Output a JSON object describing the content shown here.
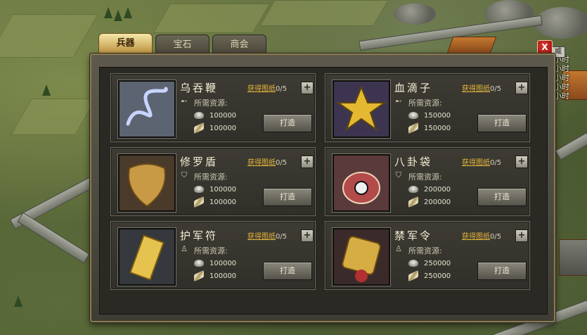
{
  "tabs": [
    {
      "label": "兵器",
      "active": true
    },
    {
      "label": "宝石",
      "active": false
    },
    {
      "label": "商会",
      "active": false
    }
  ],
  "close_label": "X",
  "close_tail_text": "威",
  "side_hints": [
    "小时",
    "小时",
    "小时",
    "小时",
    "小时"
  ],
  "card_common": {
    "blueprint_link": "获得图纸",
    "required_label": "所需资源:",
    "forge_label": "打造",
    "plus_label": "+"
  },
  "items": [
    {
      "name": "乌吞鞭",
      "count": "0/5",
      "req_icon": "whip-icon",
      "silver": "100000",
      "wood": "100000",
      "theme": "#6b7bd0",
      "art": "whip"
    },
    {
      "name": "血滴子",
      "count": "0/5",
      "req_icon": "whip-icon",
      "silver": "150000",
      "wood": "150000",
      "theme": "#e4b830",
      "art": "star"
    },
    {
      "name": "修罗盾",
      "count": "0/5",
      "req_icon": "shield-icon",
      "silver": "100000",
      "wood": "100000",
      "theme": "#c89a45",
      "art": "shield"
    },
    {
      "name": "八卦袋",
      "count": "0/5",
      "req_icon": "shield-icon",
      "silver": "200000",
      "wood": "200000",
      "theme": "#b44b4b",
      "art": "bag"
    },
    {
      "name": "护军符",
      "count": "0/5",
      "req_icon": "person-icon",
      "silver": "100000",
      "wood": "100000",
      "theme": "#e6c24f",
      "art": "talisman"
    },
    {
      "name": "禁军令",
      "count": "0/5",
      "req_icon": "person-icon",
      "silver": "250000",
      "wood": "250000",
      "theme": "#d6ad44",
      "art": "token"
    }
  ]
}
